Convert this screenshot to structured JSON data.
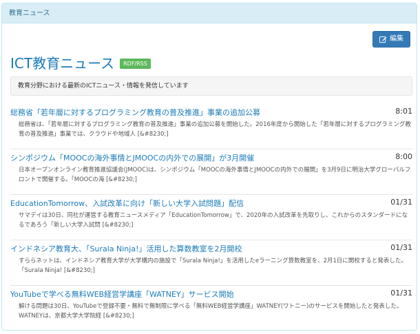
{
  "panel": {
    "heading": "教育ニュース"
  },
  "toolbar": {
    "edit_label": "編集"
  },
  "page": {
    "title": "ICT教育ニュース",
    "badge": "RDF/RSS",
    "description": "教育分野における最新のICTニュース・情報を発信しています"
  },
  "news": [
    {
      "title": "総務省「若年層に対するプログラミング教育の普及推進」事業の追加公募",
      "time": "8:01",
      "summary": "総務省は、「若年層に対するプログラミング教育の普及推進」事業の追加公募を開始した。2016年度から開始した「若年層に対するプログラミング教育の普及推進」事業では、クラウドや地域人 [&#8230;]"
    },
    {
      "title": "シンポジウム「MOOCの海外事情とJMOOCの内外での展開」が3月開催",
      "time": "8:00",
      "summary": "日本オープンオンライン教育推進協議会(JMOOC)は、シンポジウム「MOOCの海外事情とJMOOCの内外での展開」を3月9日に明治大学グローバルフロントで開催する。「MOOCの海 [&#8230;]"
    },
    {
      "title": "EducationTomorrow、入試改革に向け「新しい大学入試問題」配信",
      "time": "01/31",
      "summary": "サマデイは30日、同社が運営する教育ニュースメディア「EducationTomorrow」で、2020年の入試改革を先取りし、これからのスタンダードになるであろう「新しい大学入試問 [&#8230;]"
    },
    {
      "title": "インドネシア教育大、「Surala Ninja!」活用した算数教室を2月開校",
      "time": "01/31",
      "summary": "すららネットは、インドネシア教育大学が大学構内の施設で「Surala Ninja!」を活用したeラーニング算数教室を、2月1日に開校すると発表した。「Surala Ninja! [&#8230;]"
    },
    {
      "title": "YouTubeで学べる無料WEB経営学講座「WATNEY」サービス開始",
      "time": "01/31",
      "summary": "解ける問題は30日、YouTubeで登録不要・無料で無制限に学べる「無料WEB経営学講座」WATNEY(ワトニー)のサービスを開始したと発表した。WATNEYは、京都大学大学院経 [&#8230;]"
    }
  ]
}
